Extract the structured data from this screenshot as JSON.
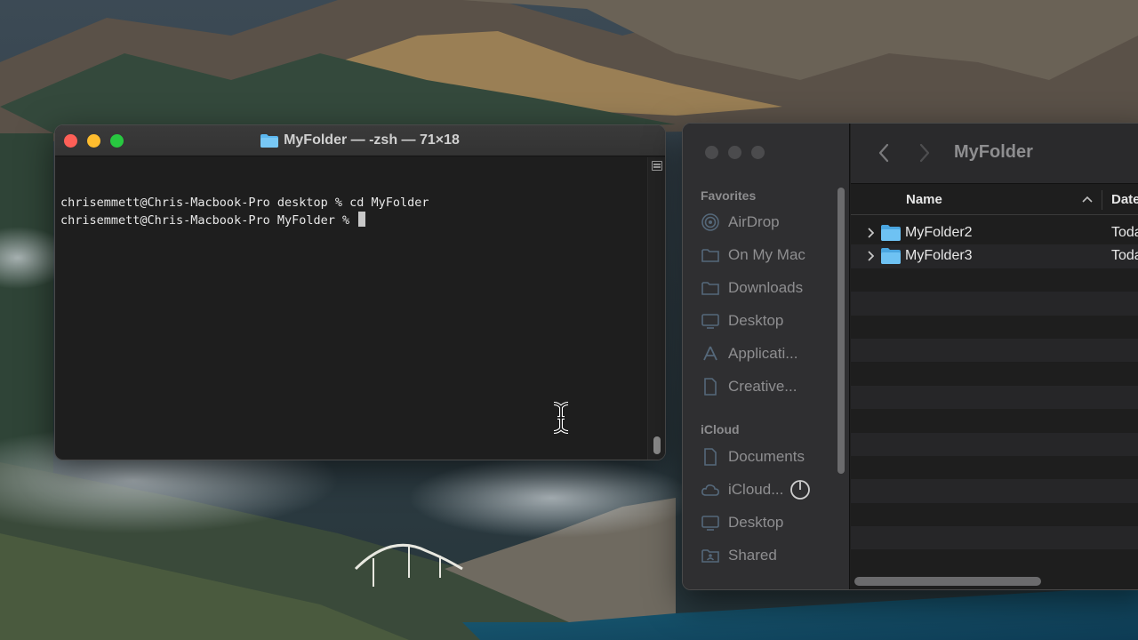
{
  "terminal": {
    "title": "MyFolder — -zsh — 71×18",
    "lines": [
      "chrisemmett@Chris-Macbook-Pro desktop % cd MyFolder",
      "chrisemmett@Chris-Macbook-Pro MyFolder % "
    ]
  },
  "finder": {
    "title": "MyFolder",
    "sidebar": {
      "favorites_label": "Favorites",
      "favorites": [
        {
          "label": "AirDrop",
          "icon": "airdrop-icon"
        },
        {
          "label": "On My Mac",
          "icon": "folder-icon"
        },
        {
          "label": "Downloads",
          "icon": "folder-icon"
        },
        {
          "label": "Desktop",
          "icon": "desktop-icon"
        },
        {
          "label": "Applicati...",
          "icon": "applications-icon"
        },
        {
          "label": "Creative...",
          "icon": "document-icon"
        }
      ],
      "icloud_label": "iCloud",
      "icloud": [
        {
          "label": "Documents",
          "icon": "document-icon"
        },
        {
          "label": "iCloud...",
          "icon": "cloud-icon"
        },
        {
          "label": "Desktop",
          "icon": "desktop-icon"
        },
        {
          "label": "Shared",
          "icon": "shared-folder-icon"
        }
      ]
    },
    "columns": {
      "name": "Name",
      "date": "Date"
    },
    "files": [
      {
        "name": "MyFolder2",
        "date": "Today"
      },
      {
        "name": "MyFolder3",
        "date": "Today"
      }
    ]
  },
  "colors": {
    "close": "#fe5f57",
    "minimize": "#febc2e",
    "maximize": "#28c840",
    "folder_blue": "#5cb8f0"
  }
}
